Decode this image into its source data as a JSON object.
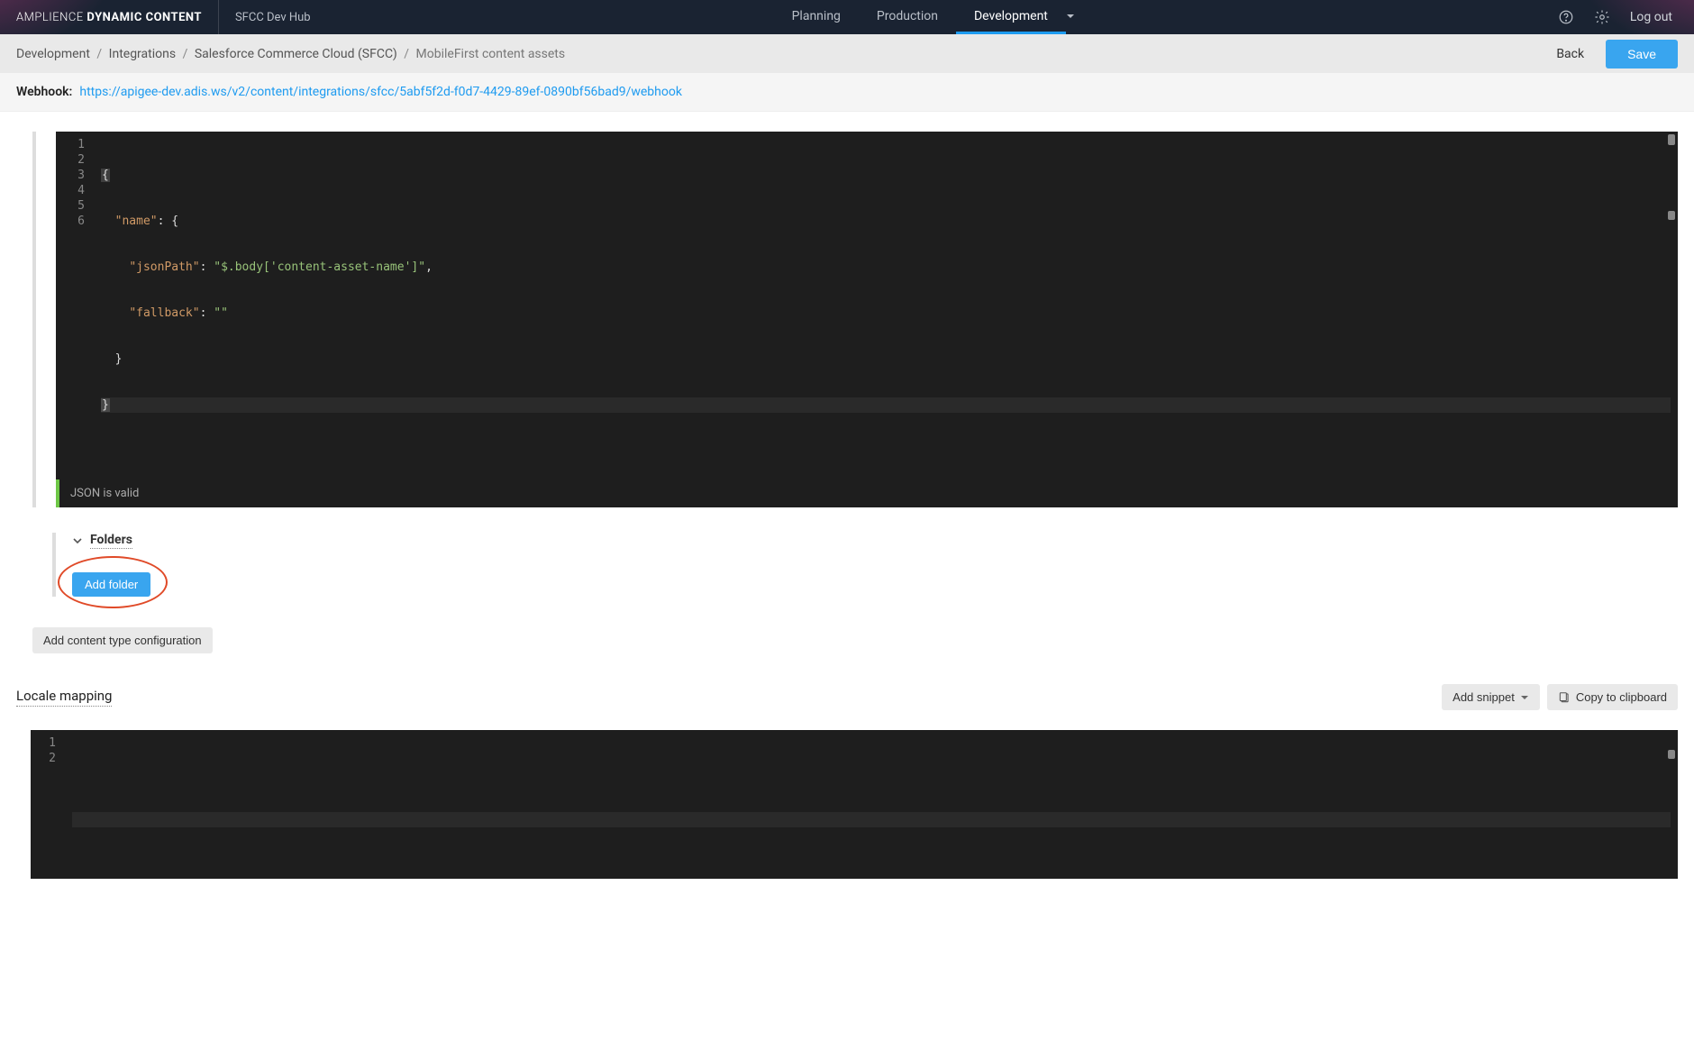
{
  "brand": {
    "light": "AMPLIENCE",
    "bold": "DYNAMIC CONTENT"
  },
  "hubLabel": "SFCC Dev Hub",
  "navTabs": {
    "planning": "Planning",
    "production": "Production",
    "development": "Development"
  },
  "activeTab": "Development",
  "logout": "Log out",
  "breadcrumb": {
    "items": [
      "Development",
      "Integrations",
      "Salesforce Commerce Cloud (SFCC)"
    ],
    "current": "MobileFirst content assets"
  },
  "back": "Back",
  "save": "Save",
  "webhook": {
    "label": "Webhook:",
    "url": "https://apigee-dev.adis.ws/v2/content/integrations/sfcc/5abf5f2d-f0d7-4429-89ef-0890bf56bad9/webhook"
  },
  "editor1": {
    "lines": [
      "1",
      "2",
      "3",
      "4",
      "5",
      "6"
    ],
    "validMsg": "JSON is valid",
    "code": {
      "l1_brace": "{",
      "l2_key": "\"name\"",
      "l2_colon": ":",
      "l2_brace": "{",
      "l3_key": "\"jsonPath\"",
      "l3_colon": ":",
      "l3_val": "\"$.body['content-asset-name']\"",
      "l3_comma": ",",
      "l4_key": "\"fallback\"",
      "l4_colon": ":",
      "l4_val": "\"\"",
      "l5_brace": "}",
      "l6_brace": "}"
    }
  },
  "folders": {
    "title": "Folders",
    "addBtn": "Add folder"
  },
  "addContentTypeBtn": "Add content type configuration",
  "localeMapping": {
    "title": "Locale mapping",
    "addSnippet": "Add snippet",
    "copy": "Copy to clipboard",
    "lines": [
      "1",
      "2"
    ]
  }
}
